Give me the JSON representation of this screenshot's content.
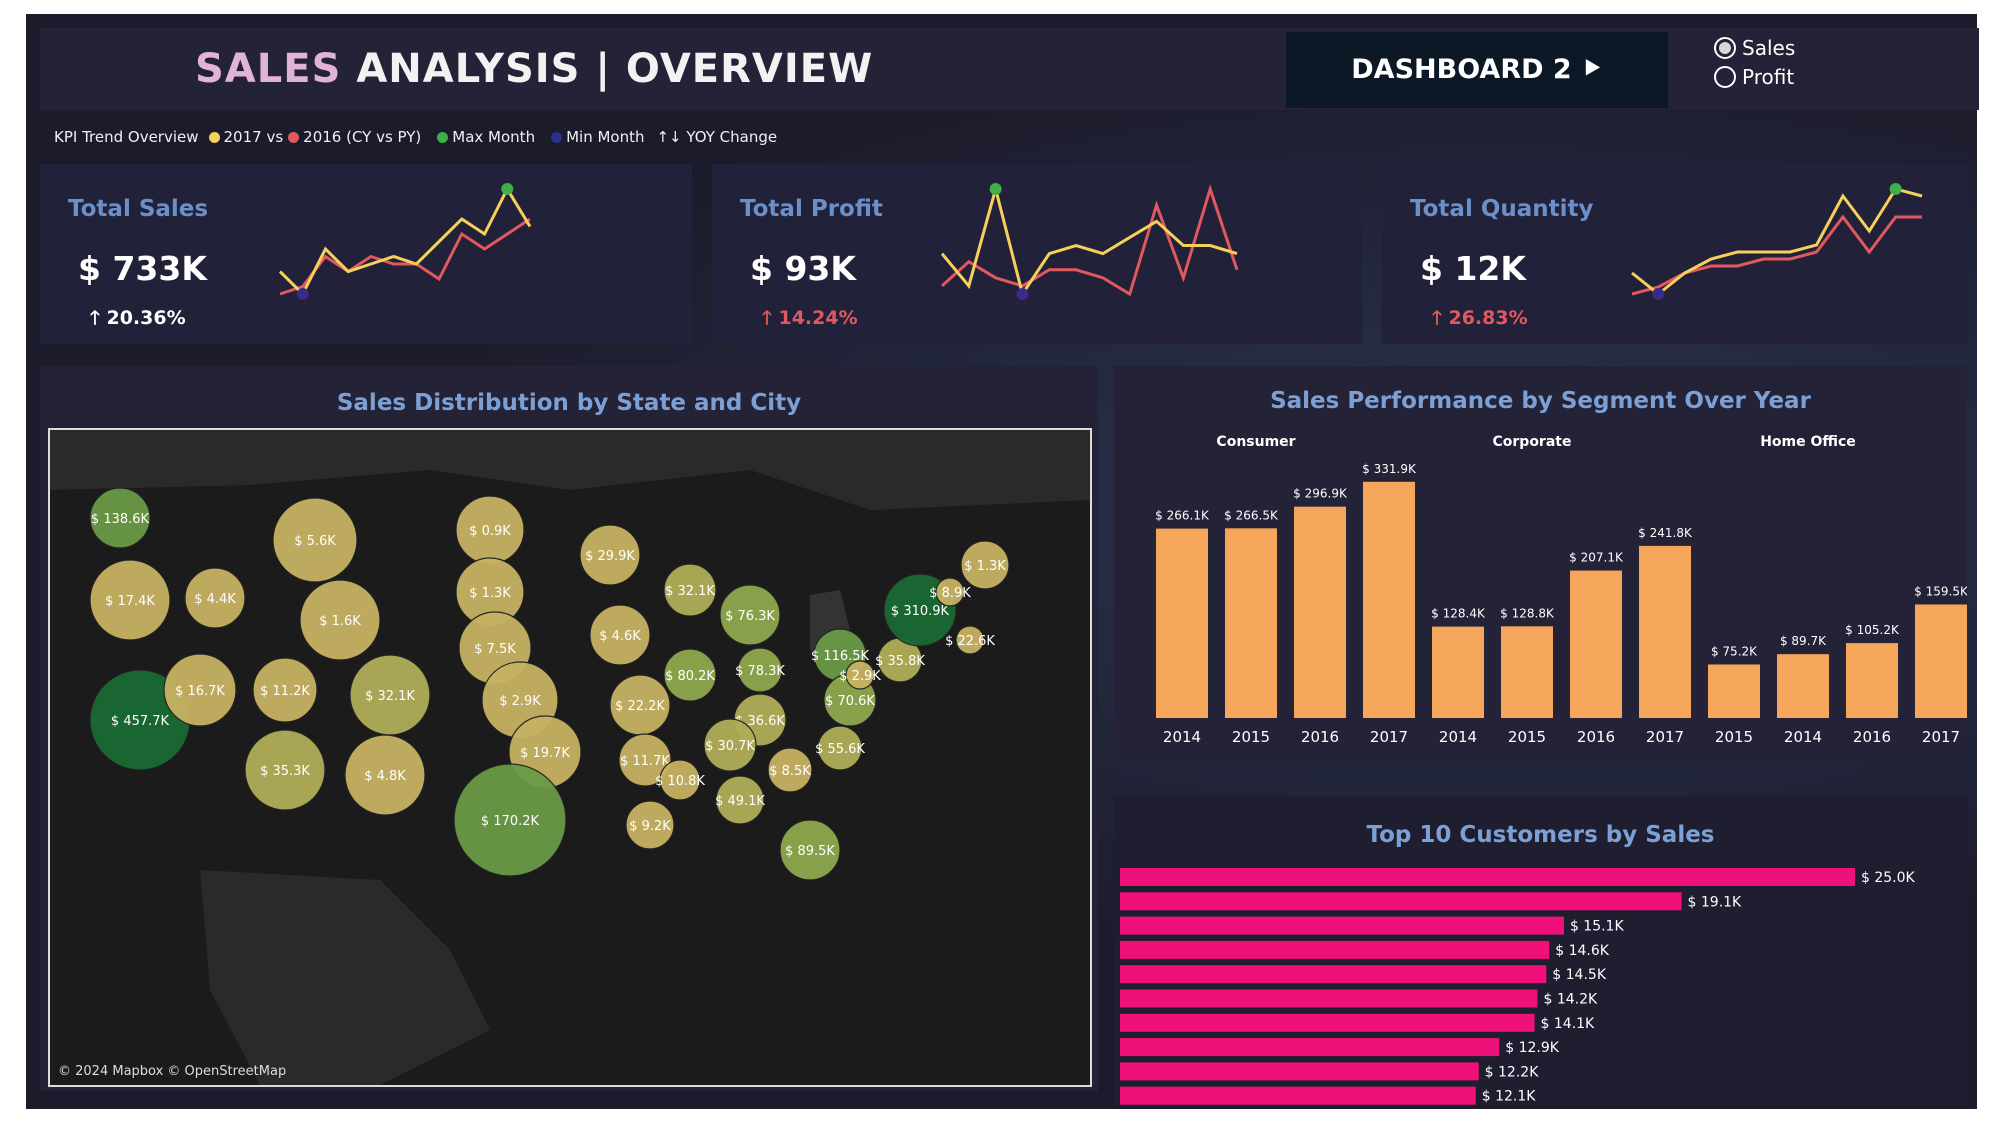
{
  "header": {
    "title_accent": "SALES",
    "title_rest": "ANALYSIS | OVERVIEW",
    "dashboard_button": "DASHBOARD 2 ⯈",
    "toggle_options": [
      "Sales",
      "Profit"
    ],
    "toggle_selected": "Sales"
  },
  "legend": {
    "prefix": "KPI Trend Overview",
    "items": [
      {
        "label": "2017 vs",
        "color": "#f5d15a"
      },
      {
        "label": "2016 (CY vs PY)",
        "color": "#e0595f"
      },
      {
        "label": "Max Month",
        "color": "#3fae4b"
      },
      {
        "label": "Min Month",
        "color": "#2a2f8a"
      }
    ],
    "yoy_label": "↑↓ YOY Change"
  },
  "kpis": [
    {
      "title": "Total Sales",
      "value": "$ 733K",
      "change": "🡑 20.36%",
      "change_color": "#ffffff",
      "cy": [
        5,
        2,
        8,
        5,
        6,
        7,
        6,
        9,
        12,
        10,
        16,
        11
      ],
      "py": [
        2,
        3,
        7,
        5,
        7,
        6,
        6,
        4,
        10,
        8,
        10,
        12
      ],
      "max_month": 10,
      "min_month": 1
    },
    {
      "title": "Total Profit",
      "value": "$ 93K",
      "change": "🡑 14.24%",
      "change_color": "#e0595f",
      "cy": [
        6,
        2,
        14,
        1,
        6,
        7,
        6,
        8,
        10,
        7,
        7,
        6
      ],
      "py": [
        2,
        5,
        3,
        2,
        4,
        4,
        3,
        1,
        12,
        3,
        14,
        4
      ],
      "max_month": 2,
      "min_month": 3
    },
    {
      "title": "Total Quantity",
      "value": "$ 12K",
      "change": "🡑 26.83%",
      "change_color": "#e0595f",
      "cy": [
        5,
        2,
        5,
        7,
        8,
        8,
        8,
        9,
        16,
        11,
        17,
        16
      ],
      "py": [
        2,
        3,
        5,
        6,
        6,
        7,
        7,
        8,
        13,
        8,
        13,
        13
      ],
      "max_month": 10,
      "min_month": 1
    }
  ],
  "map": {
    "title": "Sales Distribution by State and City",
    "credit": "© 2024 Mapbox © OpenStreetMap",
    "states": [
      {
        "name": "WA",
        "label": "$ 138.6K",
        "value": 138.6
      },
      {
        "name": "OR",
        "label": "$ 17.4K",
        "value": 17.4
      },
      {
        "name": "CA",
        "label": "$ 457.7K",
        "value": 457.7
      },
      {
        "name": "ID",
        "label": "$ 4.4K",
        "value": 4.4
      },
      {
        "name": "NV",
        "label": "$ 16.7K",
        "value": 16.7
      },
      {
        "name": "MT",
        "label": "$ 5.6K",
        "value": 5.6
      },
      {
        "name": "WY",
        "label": "$ 1.6K",
        "value": 1.6
      },
      {
        "name": "UT",
        "label": "$ 11.2K",
        "value": 11.2
      },
      {
        "name": "AZ",
        "label": "$ 35.3K",
        "value": 35.3
      },
      {
        "name": "CO",
        "label": "$ 32.1K",
        "value": 32.1
      },
      {
        "name": "NM",
        "label": "$ 4.8K",
        "value": 4.8
      },
      {
        "name": "ND",
        "label": "$ 0.9K",
        "value": 0.9
      },
      {
        "name": "SD",
        "label": "$ 1.3K",
        "value": 1.3
      },
      {
        "name": "NE",
        "label": "$ 7.5K",
        "value": 7.5
      },
      {
        "name": "KS",
        "label": "$ 2.9K",
        "value": 2.9
      },
      {
        "name": "OK",
        "label": "$ 19.7K",
        "value": 19.7
      },
      {
        "name": "TX",
        "label": "$ 170.2K",
        "value": 170.2
      },
      {
        "name": "MN",
        "label": "$ 29.9K",
        "value": 29.9
      },
      {
        "name": "IA",
        "label": "$ 4.6K",
        "value": 4.6
      },
      {
        "name": "MO",
        "label": "$ 22.2K",
        "value": 22.2
      },
      {
        "name": "AR",
        "label": "$ 11.7K",
        "value": 11.7
      },
      {
        "name": "LA",
        "label": "$ 9.2K",
        "value": 9.2
      },
      {
        "name": "WI",
        "label": "$ 32.1K",
        "value": 32.1
      },
      {
        "name": "IL",
        "label": "$ 80.2K",
        "value": 80.2
      },
      {
        "name": "MI",
        "label": "$ 76.3K",
        "value": 76.3
      },
      {
        "name": "IN",
        "label": "$ 78.3K",
        "value": 78.3
      },
      {
        "name": "OH",
        "label": "$ 116.5K",
        "value": 116.5
      },
      {
        "name": "KY",
        "label": "$ 36.6K",
        "value": 36.6
      },
      {
        "name": "TN",
        "label": "$ 30.7K",
        "value": 30.7
      },
      {
        "name": "MS",
        "label": "$ 10.8K",
        "value": 10.8
      },
      {
        "name": "AL",
        "label": "$ 49.1K",
        "value": 49.1
      },
      {
        "name": "GA",
        "label": "$ 8.5K",
        "value": 8.5
      },
      {
        "name": "FL",
        "label": "$ 89.5K",
        "value": 89.5
      },
      {
        "name": "SC",
        "label": "$ 55.6K",
        "value": 55.6
      },
      {
        "name": "VA",
        "label": "$ 70.6K",
        "value": 70.6
      },
      {
        "name": "WV",
        "label": "$ 2.9K",
        "value": 2.9
      },
      {
        "name": "PA",
        "label": "$ 35.8K",
        "value": 35.8
      },
      {
        "name": "NY",
        "label": "$ 310.9K",
        "value": 310.9
      },
      {
        "name": "NJ",
        "label": "$ 22.6K",
        "value": 22.6
      },
      {
        "name": "VT",
        "label": "$ 8.9K",
        "value": 8.9
      },
      {
        "name": "ME",
        "label": "$ 1.3K",
        "value": 1.3
      }
    ]
  },
  "chart_data": [
    {
      "type": "bar",
      "title": "Sales Performance by Segment  Over Year",
      "bar_color": "#f5a65b",
      "segments": [
        {
          "name": "Consumer",
          "categories": [
            "2014",
            "2015",
            "2016",
            "2017"
          ],
          "values": [
            266.1,
            266.5,
            296.9,
            331.9
          ],
          "labels": [
            "$ 266.1K",
            "$ 266.5K",
            "$ 296.9K",
            "$ 331.9K"
          ]
        },
        {
          "name": "Corporate",
          "categories": [
            "2014",
            "2015",
            "2016",
            "2017"
          ],
          "values": [
            128.4,
            128.8,
            207.1,
            241.8
          ],
          "labels": [
            "$ 128.4K",
            "$ 128.8K",
            "$ 207.1K",
            "$ 241.8K"
          ]
        },
        {
          "name": "Home Office",
          "categories": [
            "2015",
            "2014",
            "2016",
            "2017"
          ],
          "values": [
            75.2,
            89.7,
            105.2,
            159.5
          ],
          "labels": [
            "$ 75.2K",
            "$ 89.7K",
            "$ 105.2K",
            "$ 159.5K"
          ]
        }
      ],
      "ylim": [
        0,
        340
      ]
    },
    {
      "type": "bar",
      "orientation": "horizontal",
      "title": "Top 10 Customers by Sales",
      "bar_color": "#f0107a",
      "values": [
        25.0,
        19.1,
        15.1,
        14.6,
        14.5,
        14.2,
        14.1,
        12.9,
        12.2,
        12.1
      ],
      "labels": [
        "$ 25.0K",
        "$ 19.1K",
        "$ 15.1K",
        "$ 14.6K",
        "$ 14.5K",
        "$ 14.2K",
        "$ 14.1K",
        "$ 12.9K",
        "$ 12.2K",
        "$ 12.1K"
      ],
      "xlim": [
        0,
        25.0
      ]
    }
  ]
}
